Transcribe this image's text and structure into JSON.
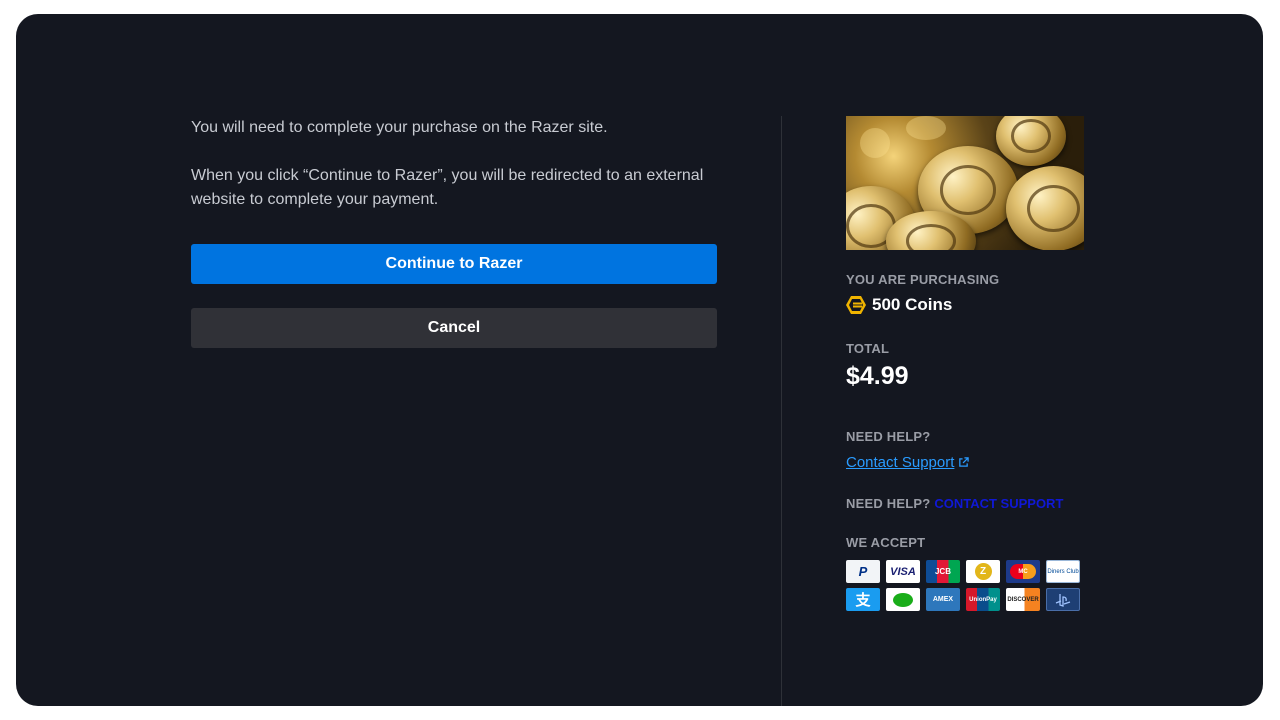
{
  "message": {
    "line1": "You will need to complete your purchase on the Razer site.",
    "line2": "When you click “Continue to Razer”, you will be redirected to an external website to complete your payment."
  },
  "buttons": {
    "continue_label": "Continue to Razer",
    "cancel_label": "Cancel"
  },
  "summary": {
    "purchasing_label": "YOU ARE PURCHASING",
    "item_name": "500 Coins",
    "total_label": "TOTAL",
    "total_value": "$4.99",
    "help_label": "NEED HELP?",
    "contact_link": "Contact Support",
    "help_label_2": "NEED HELP?",
    "contact_link_2": "CONTACT SUPPORT",
    "accept_label": "WE ACCEPT"
  },
  "payment_methods": [
    {
      "name": "paypal",
      "text": "P"
    },
    {
      "name": "visa",
      "text": "VISA"
    },
    {
      "name": "jcb",
      "text": "JCB"
    },
    {
      "name": "razer-gold",
      "text": "Z"
    },
    {
      "name": "mastercard",
      "text": "MC"
    },
    {
      "name": "diners-club",
      "text": "Diners Club"
    },
    {
      "name": "alipay",
      "text": "支"
    },
    {
      "name": "wechat-pay",
      "text": ""
    },
    {
      "name": "american-express",
      "text": "AMEX"
    },
    {
      "name": "unionpay",
      "text": "UnionPay"
    },
    {
      "name": "discover",
      "text": "DISCOVER"
    },
    {
      "name": "playstation",
      "text": ""
    }
  ],
  "colors": {
    "background": "#141720",
    "primary": "#0074e0",
    "secondary": "#303137",
    "link": "#2a9cff",
    "coin": "#f0b400"
  }
}
